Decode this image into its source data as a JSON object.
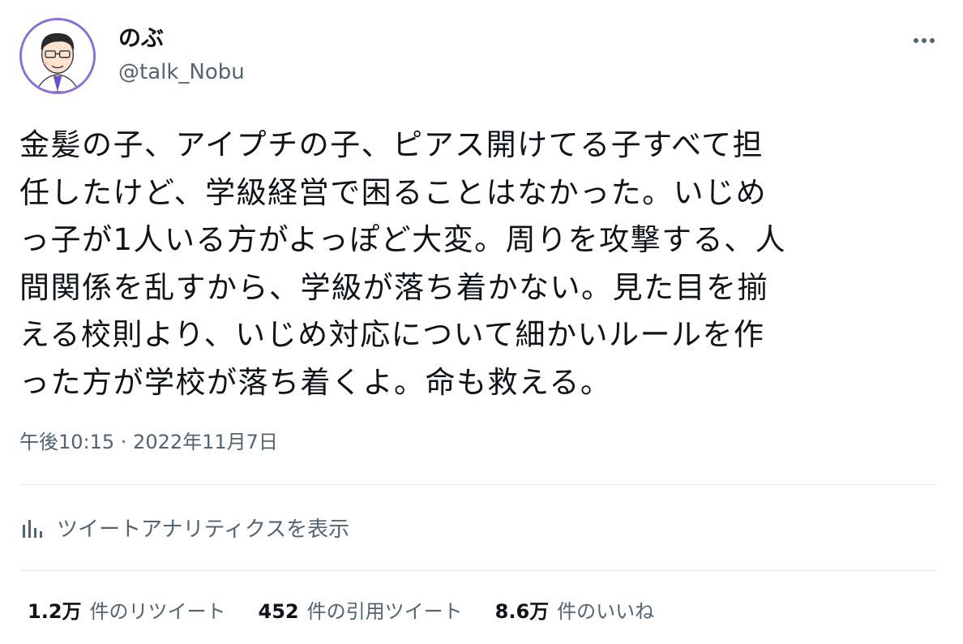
{
  "author": {
    "display_name": "のぶ",
    "handle": "@talk_Nobu",
    "avatar_icon": "avatar-illustration-man-glasses"
  },
  "tweet": {
    "text": "金髪の子、アイプチの子、ピアス開けてる子すべて担\n任したけど、学級経営で困ることはなかった。いじめ\nっ子が1人いる方がよっぽど大変。周りを攻撃する、人\n間関係を乱すから、学級が落ち着かない。見た目を揃\nえる校則より、いじめ対応について細かいルールを作\nった方が学校が落ち着くよ。命も救える。",
    "timestamp": "午後10:15 · 2022年11月7日"
  },
  "analytics": {
    "label": "ツイートアナリティクスを表示",
    "icon": "bar-chart-icon"
  },
  "stats": [
    {
      "count": "1.2万",
      "label": "件のリツイート"
    },
    {
      "count": "452",
      "label": "件の引用ツイート"
    },
    {
      "count": "8.6万",
      "label": "件のいいね"
    }
  ],
  "colors": {
    "text": "#0f1419",
    "secondary": "#536471",
    "divider": "#e6e9ec",
    "avatar_ring": "#8a6fd8"
  }
}
